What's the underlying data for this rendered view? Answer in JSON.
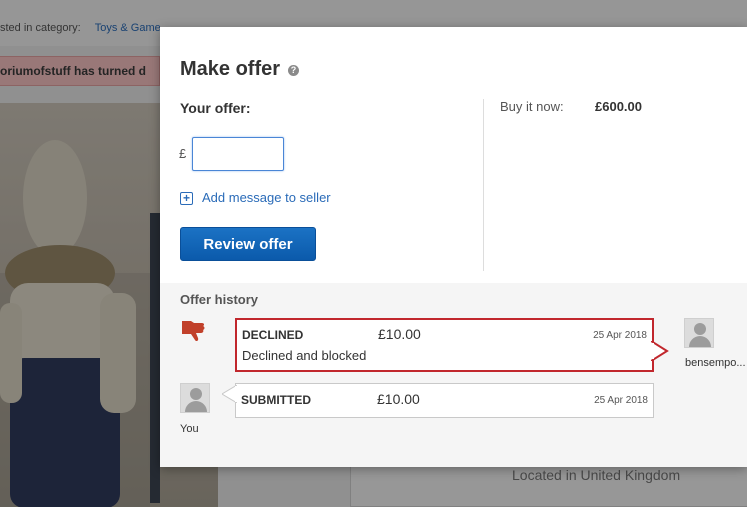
{
  "background": {
    "category_prefix": "sted in category:",
    "category_link": "Toys & Game",
    "alert_text": "oriumofstuff has turned d",
    "located_text": "Located in United Kingdom"
  },
  "modal": {
    "title": "Make offer",
    "help_icon": "?",
    "your_offer_label": "Your offer:",
    "currency_symbol": "£",
    "offer_value": "",
    "add_message_label": "Add message to seller",
    "add_icon": "+",
    "review_button_label": "Review offer",
    "buy_it_now_label": "Buy it now:",
    "buy_it_now_price": "£600.00"
  },
  "history": {
    "title": "Offer history",
    "entries": [
      {
        "status": "DECLINED",
        "amount": "£10.00",
        "date": "25 Apr 2018",
        "note": "Declined and blocked",
        "side": "seller",
        "icon": "thumbs-down-icon"
      },
      {
        "status": "SUBMITTED",
        "amount": "£10.00",
        "date": "25 Apr 2018",
        "note": "",
        "side": "buyer"
      }
    ],
    "seller_name": "bensempo...",
    "you_label": "You"
  },
  "colors": {
    "accent_blue": "#0b5aab",
    "link_blue": "#2a6bb8",
    "declined_red": "#c1272d",
    "thumbs_down": "#c1402a",
    "alert_bg": "#f7c2c2"
  }
}
